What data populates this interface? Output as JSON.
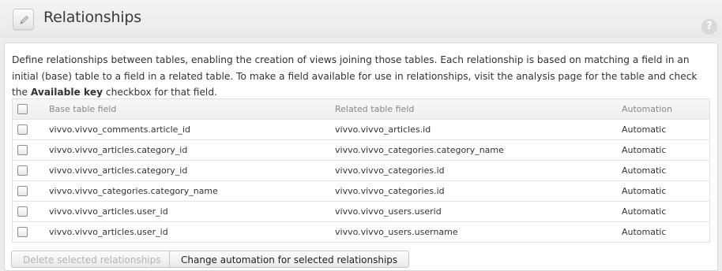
{
  "header": {
    "title": "Relationships",
    "page_icon": "pencil-icon",
    "help_label": "?"
  },
  "description": {
    "text": "Define relationships between tables, enabling the creation of views joining those tables. Each relationship is based on matching a field in an initial (base) table to a field in a related table. To make a field available for use in relationships, visit the analysis page for the table and check the ",
    "bold": "Available key",
    "suffix": " checkbox for that field."
  },
  "table": {
    "columns": {
      "base": "Base table field",
      "related": "Related table field",
      "automation": "Automation"
    },
    "rows": [
      {
        "base": "vivvo.vivvo_comments.article_id",
        "related": "vivvo.vivvo_articles.id",
        "automation": "Automatic"
      },
      {
        "base": "vivvo.vivvo_articles.category_id",
        "related": "vivvo.vivvo_categories.category_name",
        "automation": "Automatic"
      },
      {
        "base": "vivvo.vivvo_articles.category_id",
        "related": "vivvo.vivvo_categories.id",
        "automation": "Automatic"
      },
      {
        "base": "vivvo.vivvo_categories.category_name",
        "related": "vivvo.vivvo_categories.id",
        "automation": "Automatic"
      },
      {
        "base": "vivvo.vivvo_articles.user_id",
        "related": "vivvo.vivvo_users.userid",
        "automation": "Automatic"
      },
      {
        "base": "vivvo.vivvo_articles.user_id",
        "related": "vivvo.vivvo_users.username",
        "automation": "Automatic"
      }
    ]
  },
  "buttons": {
    "delete_label": "Delete selected relationships",
    "change_label": "Change automation for selected relationships"
  }
}
